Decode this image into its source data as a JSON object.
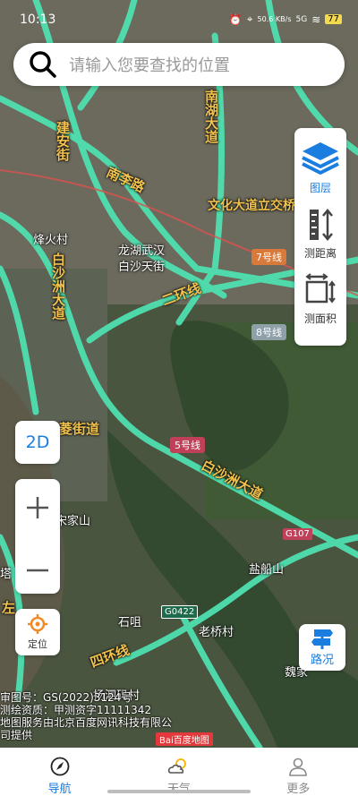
{
  "status_bar": {
    "time": "10:13",
    "network_speed": "50.6 KB/s",
    "signal": "5G",
    "battery": "77"
  },
  "search": {
    "placeholder": "请输入您要查找的位置"
  },
  "tools": [
    {
      "label": "图层",
      "icon": "layers-icon",
      "active": true
    },
    {
      "label": "测距离",
      "icon": "measure-distance-icon",
      "active": false
    },
    {
      "label": "测面积",
      "icon": "measure-area-icon",
      "active": false
    }
  ],
  "controls": {
    "view_mode": "2D",
    "locate_label": "定位",
    "traffic_label": "路况"
  },
  "map_labels": {
    "road_nanhu": "南湖大道",
    "road_jianan": "建安街",
    "road_nanli": "南李路",
    "road_wenhua": "文化大道立交桥",
    "place_fenghuo": "烽火村",
    "place_longhu": "龙湖武汉",
    "place_baisha_street": "白沙天街",
    "road_baishazhou": "白沙洲大道",
    "road_erhuan": "二环线",
    "metro_7": "7号线",
    "metro_8": "8号线",
    "metro_5": "5号线",
    "road_lingjie": "菱街道",
    "road_baishazhou2": "白沙洲大道",
    "highway_g107": "G107",
    "place_yanchuanshan": "盐船山",
    "place_zhangjiashan": "宋家山",
    "place_shiju": "石咀",
    "highway_g0422": "G0422",
    "place_laoqiaocun": "老桥村",
    "road_sihuan": "四环线",
    "place_yangqiao": "扬泗码村",
    "place_weijia": "魏家",
    "place_tazi": "塔",
    "place_zuo": "左"
  },
  "copyright": {
    "line1": "审图号：GS(2022)3124号",
    "line2": "测绘资质：甲测资字11111342",
    "line3": "地图服务由北京百度网讯科技有限公",
    "line4": "司提供",
    "logo": "Bai百度地图"
  },
  "tabs": [
    {
      "label": "导航",
      "icon": "navigation-icon",
      "active": true
    },
    {
      "label": "天气",
      "icon": "weather-icon",
      "active": false
    },
    {
      "label": "更多",
      "icon": "user-icon",
      "active": false
    }
  ],
  "colors": {
    "accent": "#1a7de0",
    "road": "#4fe0b0",
    "metro": "#d9534f"
  }
}
